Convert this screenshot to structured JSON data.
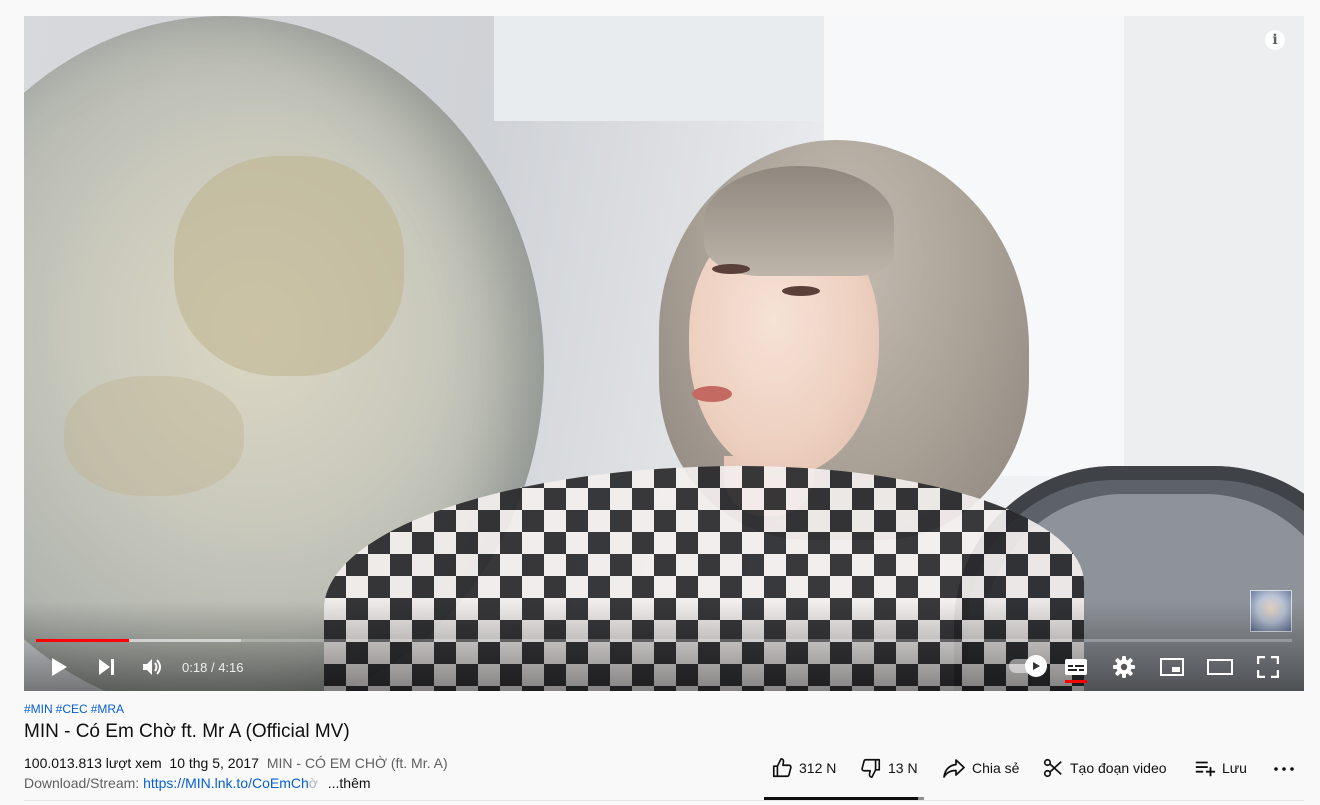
{
  "player": {
    "current_time": "0:18",
    "separator": "/",
    "duration": "4:16",
    "played_fraction": 0.074,
    "buffered_fraction": 0.163,
    "info_icon": "info-icon",
    "controls": [
      "play-icon",
      "next-icon",
      "volume-icon",
      "autoplay-toggle",
      "subtitles-icon",
      "settings-icon",
      "miniplayer-icon",
      "theater-icon",
      "fullscreen-icon"
    ]
  },
  "video": {
    "hashtags": [
      "#MIN",
      "#CEC",
      "#MRA"
    ],
    "title": "MIN - Có Em Chờ ft. Mr A (Official MV)",
    "views": "100.013.813 lượt xem",
    "date": "10 thg 5, 2017",
    "description_preview": "MIN - CÓ EM CHỜ (ft. Mr. A)",
    "download_prefix": "Download/Stream:",
    "download_link": "https://MIN.lnk.to/CoEmCh",
    "download_link_fade": "ờ",
    "more_label": "...thêm"
  },
  "actions": {
    "likes": "312 N",
    "dislikes": "13 N",
    "share": "Chia sẻ",
    "clip": "Tạo đoạn video",
    "save": "Lưu",
    "like_ratio": 0.96
  },
  "colors": {
    "accent": "#ff0000",
    "link": "#065fd4"
  }
}
